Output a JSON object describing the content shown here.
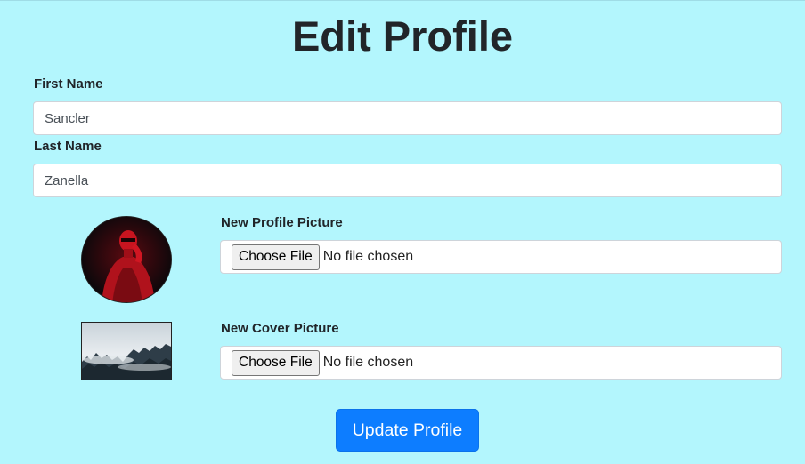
{
  "page": {
    "title": "Edit Profile",
    "background_color": "#b3f6fd"
  },
  "form": {
    "first_name": {
      "label": "First Name",
      "value": "Sancler"
    },
    "last_name": {
      "label": "Last Name",
      "value": "Zanella"
    },
    "profile_picture": {
      "label": "New Profile Picture",
      "button_label": "Choose File",
      "status": "No file chosen",
      "current_image": "profile-photo"
    },
    "cover_picture": {
      "label": "New Cover Picture",
      "button_label": "Choose File",
      "status": "No file chosen",
      "current_image": "cover-photo"
    },
    "submit": {
      "label": "Update Profile",
      "color": "#0d7dff"
    }
  }
}
